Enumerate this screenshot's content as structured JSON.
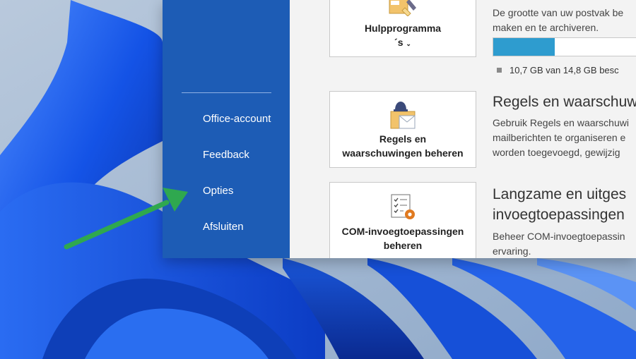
{
  "nav": {
    "items": [
      {
        "label": "Office-account"
      },
      {
        "label": "Feedback"
      },
      {
        "label": "Opties"
      },
      {
        "label": "Afsluiten"
      }
    ]
  },
  "tools": {
    "tile_label_line1": "Hulpprogramma",
    "tile_label_line2": "´s",
    "desc_line1": "De grootte van uw postvak be",
    "desc_line2": "maken en te archiveren.",
    "storage_used_fraction": 0.42,
    "storage_text": "10,7 GB van 14,8 GB besc"
  },
  "rules": {
    "tile_label_line1": "Regels en",
    "tile_label_line2": "waarschuwingen beheren",
    "heading": "Regels en waarschuw",
    "desc_line1": "Gebruik Regels en waarschuwi",
    "desc_line2": "mailberichten te organiseren e",
    "desc_line3": "worden toegevoegd, gewijzig"
  },
  "com": {
    "tile_label_line1": "COM-invoegtoepassingen",
    "tile_label_line2": "beheren",
    "heading_line1": "Langzame en uitges",
    "heading_line2": "invoegtoepassingen",
    "desc_line1": "Beheer COM-invoegtoepassin",
    "desc_line2": "ervaring."
  },
  "colors": {
    "nav_background": "#1d5cb5",
    "storage_fill": "#2e9ccf",
    "arrow": "#2fa84f"
  }
}
